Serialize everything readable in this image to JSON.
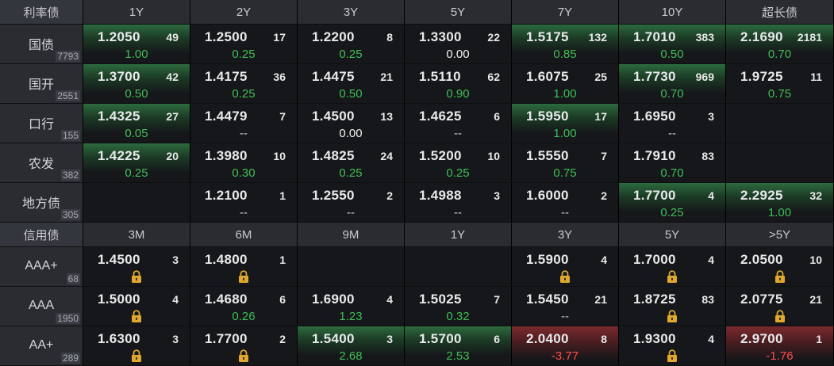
{
  "chart_data": {
    "type": "table",
    "sections": [
      {
        "title": "利率债",
        "columns": [
          "1Y",
          "2Y",
          "3Y",
          "5Y",
          "7Y",
          "10Y",
          "超长债"
        ],
        "rows": [
          {
            "name": "国债",
            "count": "7793",
            "cells": [
              {
                "price": "1.2050",
                "volume": "49",
                "change": "1.00",
                "tone": "green",
                "bg": "green"
              },
              {
                "price": "1.2500",
                "volume": "17",
                "change": "0.25",
                "tone": "green",
                "bg": "none"
              },
              {
                "price": "1.2200",
                "volume": "8",
                "change": "0.25",
                "tone": "green",
                "bg": "none"
              },
              {
                "price": "1.3300",
                "volume": "22",
                "change": "0.00",
                "tone": "white",
                "bg": "none"
              },
              {
                "price": "1.5175",
                "volume": "132",
                "change": "0.85",
                "tone": "green",
                "bg": "green"
              },
              {
                "price": "1.7010",
                "volume": "383",
                "change": "0.50",
                "tone": "green",
                "bg": "green"
              },
              {
                "price": "2.1690",
                "volume": "2181",
                "change": "0.70",
                "tone": "green",
                "bg": "green"
              }
            ]
          },
          {
            "name": "国开",
            "count": "2551",
            "cells": [
              {
                "price": "1.3700",
                "volume": "42",
                "change": "0.50",
                "tone": "green",
                "bg": "green"
              },
              {
                "price": "1.4175",
                "volume": "36",
                "change": "0.25",
                "tone": "green",
                "bg": "none"
              },
              {
                "price": "1.4475",
                "volume": "21",
                "change": "0.50",
                "tone": "green",
                "bg": "none"
              },
              {
                "price": "1.5110",
                "volume": "62",
                "change": "0.90",
                "tone": "green",
                "bg": "none"
              },
              {
                "price": "1.6075",
                "volume": "25",
                "change": "1.00",
                "tone": "green",
                "bg": "none"
              },
              {
                "price": "1.7730",
                "volume": "969",
                "change": "0.70",
                "tone": "green",
                "bg": "green"
              },
              {
                "price": "1.9725",
                "volume": "11",
                "change": "0.75",
                "tone": "green",
                "bg": "none"
              }
            ]
          },
          {
            "name": "口行",
            "count": "155",
            "cells": [
              {
                "price": "1.4325",
                "volume": "27",
                "change": "0.05",
                "tone": "green",
                "bg": "green"
              },
              {
                "price": "1.4479",
                "volume": "7",
                "change": "--",
                "tone": "dash",
                "bg": "none"
              },
              {
                "price": "1.4500",
                "volume": "13",
                "change": "0.00",
                "tone": "white",
                "bg": "none"
              },
              {
                "price": "1.4625",
                "volume": "6",
                "change": "--",
                "tone": "dash",
                "bg": "none"
              },
              {
                "price": "1.5950",
                "volume": "17",
                "change": "1.00",
                "tone": "green",
                "bg": "green"
              },
              {
                "price": "1.6950",
                "volume": "3",
                "change": "--",
                "tone": "dash",
                "bg": "none"
              },
              null
            ]
          },
          {
            "name": "农发",
            "count": "382",
            "cells": [
              {
                "price": "1.4225",
                "volume": "20",
                "change": "0.25",
                "tone": "green",
                "bg": "green"
              },
              {
                "price": "1.3980",
                "volume": "10",
                "change": "0.30",
                "tone": "green",
                "bg": "none"
              },
              {
                "price": "1.4825",
                "volume": "24",
                "change": "0.25",
                "tone": "green",
                "bg": "none"
              },
              {
                "price": "1.5200",
                "volume": "10",
                "change": "0.25",
                "tone": "green",
                "bg": "none"
              },
              {
                "price": "1.5550",
                "volume": "7",
                "change": "0.75",
                "tone": "green",
                "bg": "none"
              },
              {
                "price": "1.7910",
                "volume": "83",
                "change": "0.70",
                "tone": "green",
                "bg": "none"
              },
              null
            ]
          },
          {
            "name": "地方债",
            "count": "305",
            "cells": [
              null,
              {
                "price": "1.2100",
                "volume": "1",
                "change": "--",
                "tone": "dash",
                "bg": "none"
              },
              {
                "price": "1.2550",
                "volume": "2",
                "change": "--",
                "tone": "dash",
                "bg": "none"
              },
              {
                "price": "1.4988",
                "volume": "3",
                "change": "--",
                "tone": "dash",
                "bg": "none"
              },
              {
                "price": "1.6000",
                "volume": "2",
                "change": "--",
                "tone": "dash",
                "bg": "none"
              },
              {
                "price": "1.7700",
                "volume": "4",
                "change": "0.25",
                "tone": "green",
                "bg": "green"
              },
              {
                "price": "2.2925",
                "volume": "32",
                "change": "1.00",
                "tone": "green",
                "bg": "green"
              }
            ]
          }
        ]
      },
      {
        "title": "信用债",
        "columns": [
          "3M",
          "6M",
          "9M",
          "1Y",
          "3Y",
          "5Y",
          ">5Y"
        ],
        "rows": [
          {
            "name": "AAA+",
            "count": "68",
            "cells": [
              {
                "price": "1.4500",
                "volume": "3",
                "change": "lock",
                "tone": "lock",
                "bg": "none"
              },
              {
                "price": "1.4800",
                "volume": "1",
                "change": "lock",
                "tone": "lock",
                "bg": "none"
              },
              null,
              null,
              {
                "price": "1.5900",
                "volume": "4",
                "change": "lock",
                "tone": "lock",
                "bg": "none"
              },
              {
                "price": "1.7000",
                "volume": "4",
                "change": "lock",
                "tone": "lock",
                "bg": "none"
              },
              {
                "price": "2.0500",
                "volume": "10",
                "change": "lock",
                "tone": "lock",
                "bg": "none"
              }
            ]
          },
          {
            "name": "AAA",
            "count": "1950",
            "cells": [
              {
                "price": "1.5000",
                "volume": "4",
                "change": "lock",
                "tone": "lock",
                "bg": "none"
              },
              {
                "price": "1.4680",
                "volume": "6",
                "change": "0.26",
                "tone": "green",
                "bg": "none"
              },
              {
                "price": "1.6900",
                "volume": "4",
                "change": "1.23",
                "tone": "green",
                "bg": "none"
              },
              {
                "price": "1.5025",
                "volume": "7",
                "change": "0.32",
                "tone": "green",
                "bg": "none"
              },
              {
                "price": "1.5450",
                "volume": "21",
                "change": "--",
                "tone": "dash",
                "bg": "none"
              },
              {
                "price": "1.8725",
                "volume": "83",
                "change": "lock",
                "tone": "lock",
                "bg": "none"
              },
              {
                "price": "2.0775",
                "volume": "21",
                "change": "lock",
                "tone": "lock",
                "bg": "none"
              }
            ]
          },
          {
            "name": "AA+",
            "count": "289",
            "cells": [
              {
                "price": "1.6300",
                "volume": "3",
                "change": "lock",
                "tone": "lock",
                "bg": "none"
              },
              {
                "price": "1.7700",
                "volume": "2",
                "change": "lock",
                "tone": "lock",
                "bg": "none"
              },
              {
                "price": "1.5400",
                "volume": "3",
                "change": "2.68",
                "tone": "green",
                "bg": "green"
              },
              {
                "price": "1.5700",
                "volume": "6",
                "change": "2.53",
                "tone": "green",
                "bg": "green"
              },
              {
                "price": "2.0400",
                "volume": "8",
                "change": "-3.77",
                "tone": "red",
                "bg": "red"
              },
              {
                "price": "1.9300",
                "volume": "4",
                "change": "lock",
                "tone": "lock",
                "bg": "none"
              },
              {
                "price": "2.9700",
                "volume": "1",
                "change": "-1.76",
                "tone": "red",
                "bg": "red"
              }
            ]
          }
        ]
      }
    ]
  },
  "colors": {
    "up_green": "#3fbf55",
    "down_red": "#ff4d4d",
    "lock_gold": "#e0a82e",
    "header_bg": "#2a2c31",
    "cell_bg": "#16171a"
  }
}
